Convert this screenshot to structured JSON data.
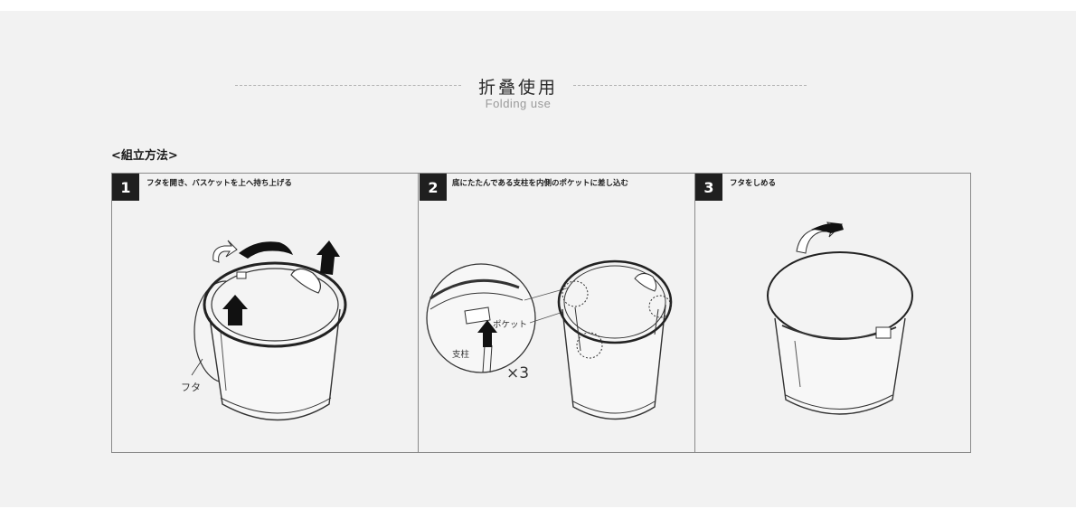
{
  "heading": {
    "title_zh": "折叠使用",
    "title_en": "Folding use"
  },
  "section_label": "<組立方法>",
  "steps": [
    {
      "number": "1",
      "text": "フタを開き、バスケットを上へ持ち上げる",
      "label_lid": "フタ"
    },
    {
      "number": "2",
      "text": "底にたたんである支柱を内側のポケットに差し込む",
      "label_pocket": "ポケット",
      "label_post": "支柱",
      "label_count": "×3"
    },
    {
      "number": "3",
      "text": "フタをしめる"
    }
  ],
  "icons": [
    "rotate-arrow-icon",
    "up-arrow-icon"
  ]
}
